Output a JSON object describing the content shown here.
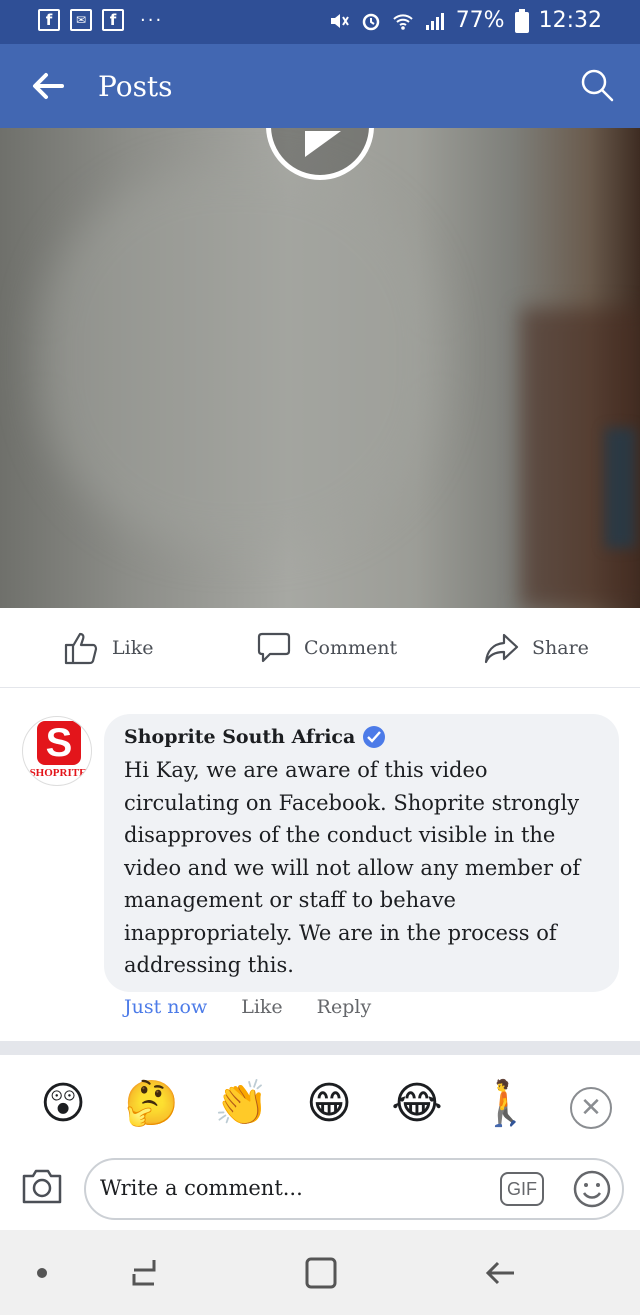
{
  "status_bar": {
    "battery": "77%",
    "time": "12:32",
    "left_icons": [
      "facebook-icon",
      "mail-icon",
      "facebook-icon",
      "more-icon"
    ],
    "dots": "···"
  },
  "header": {
    "title": "Posts"
  },
  "actions": {
    "like": "Like",
    "comment": "Comment",
    "share": "Share"
  },
  "comment": {
    "avatar_label": "SHOPRITE",
    "avatar_letter": "S",
    "author": "Shoprite South Africa",
    "text": "Hi Kay, we are aware of this video circulating on Facebook. Shoprite strongly disapproves of the conduct visible in the video and we will not allow any member of management or staff to behave inappropriately. We are in the process of addressing this.",
    "time": "Just now",
    "like": "Like",
    "reply": "Reply"
  },
  "reactions": [
    "😲",
    "🤔",
    "👏",
    "😁",
    "😂",
    "🚶"
  ],
  "composer": {
    "placeholder": "Write a comment...",
    "gif": "GIF"
  },
  "colors": {
    "header": "#4267b2",
    "status_bar": "#2f4f96",
    "link_blue": "#4c7be8",
    "bubble": "#f0f2f5"
  }
}
